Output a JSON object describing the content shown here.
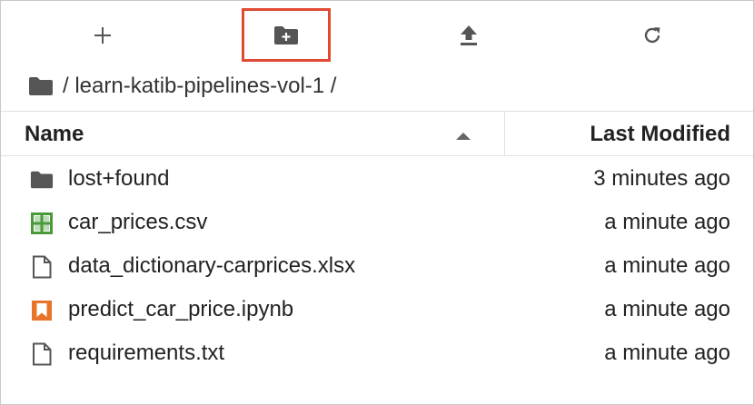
{
  "toolbar": {
    "new_icon": "plus-icon",
    "new_folder_icon": "new-folder-icon",
    "upload_icon": "upload-icon",
    "refresh_icon": "refresh-icon",
    "highlight_color": "#e04a32"
  },
  "breadcrumb": {
    "home_icon": "folder-icon",
    "path": "/ learn-katib-pipelines-vol-1 /"
  },
  "header": {
    "name_label": "Name",
    "modified_label": "Last Modified",
    "sort_icon": "sort-up-icon"
  },
  "files": [
    {
      "name": "lost+found",
      "modified": "3 minutes ago",
      "icon": "folder-icon"
    },
    {
      "name": "car_prices.csv",
      "modified": "a minute ago",
      "icon": "spreadsheet-icon"
    },
    {
      "name": "data_dictionary-carprices.xlsx",
      "modified": "a minute ago",
      "icon": "file-icon"
    },
    {
      "name": "predict_car_price.ipynb",
      "modified": "a minute ago",
      "icon": "notebook-icon"
    },
    {
      "name": "requirements.txt",
      "modified": "a minute ago",
      "icon": "file-icon"
    }
  ],
  "colors": {
    "folder": "#555555",
    "spreadsheet": "#4a9a3c",
    "notebook": "#e8742a",
    "text": "#222222",
    "border": "#e0e0e0"
  }
}
